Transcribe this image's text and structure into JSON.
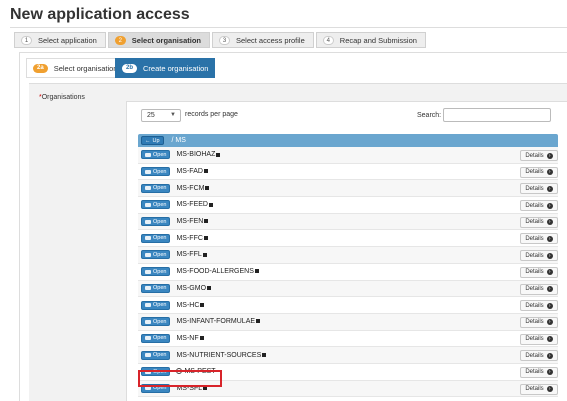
{
  "app_title": "New application access",
  "steps": [
    {
      "num": "1",
      "label": "Select application"
    },
    {
      "num": "2",
      "label": "Select organisation"
    },
    {
      "num": "3",
      "label": "Select access profile"
    },
    {
      "num": "4",
      "label": "Recap and Submission"
    }
  ],
  "subtabs": [
    {
      "badge": "2a",
      "label": "Select organisation"
    },
    {
      "badge": "2b",
      "label": "Create organisation"
    }
  ],
  "form": {
    "required_mark": "*",
    "organisations_label": "Organisations"
  },
  "table": {
    "records_value": "25",
    "records_label": "records per page",
    "search_label": "Search:",
    "search_value": "",
    "up_label": "Up",
    "path": "/ MS",
    "open_label": "Open",
    "details_label": "Details",
    "rows": [
      "MS-BIOHAZ",
      "MS-FAD",
      "MS-FCM",
      "MS-FEED",
      "MS-FEN",
      "MS-FFC",
      "MS-FFL",
      "MS-FOOD-ALLERGENS",
      "MS-GMO",
      "MS-HC",
      "MS-INFANT-FORMULAE",
      "MS-NF",
      "MS-NUTRIENT-SOURCES",
      "MS-PEST",
      "MS-SFL"
    ],
    "selected_row": "MS-PEST"
  },
  "colors": {
    "accent": "#2a72a8",
    "step_active": "#f0a030",
    "path_bar": "#6aa6cf",
    "highlight": "#d8242a"
  }
}
